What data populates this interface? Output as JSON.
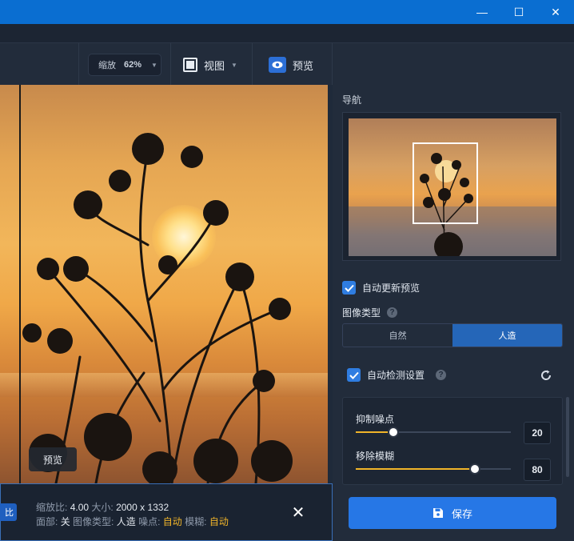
{
  "window": {
    "minimize_glyph": "—",
    "maximize_glyph": "☐",
    "close_glyph": "✕"
  },
  "toolbar": {
    "zoom_label": "缩放",
    "zoom_value": "62%",
    "view_label": "视图",
    "preview_label": "预览"
  },
  "canvas": {
    "preview_tag": "预览"
  },
  "infobar": {
    "left_button": "比",
    "zoom_ratio_label": "缩放比:",
    "zoom_ratio_value": "4.00",
    "size_label": "大小:",
    "size_value": "2000 x 1332",
    "face_label": "面部:",
    "face_value": "关",
    "image_type_label": "图像类型:",
    "image_type_value": "人造",
    "noise_label": "噪点:",
    "noise_value": "自动",
    "blur_label": "模糊:",
    "blur_value": "自动"
  },
  "panel": {
    "navigation_title": "导航",
    "auto_update_preview": "自动更新预览",
    "image_type_title": "图像类型",
    "image_type_options": [
      "自然",
      "人造"
    ],
    "image_type_selected": 1,
    "auto_detect_settings": "自动检测设置",
    "sliders": [
      {
        "label": "抑制噪点",
        "value": "20",
        "fraction": 0.24
      },
      {
        "label": "移除模糊",
        "value": "80",
        "fraction": 0.77
      }
    ],
    "save_label": "保存"
  },
  "colors": {
    "accent": "#2677e6",
    "titlebar": "#0a6ed1",
    "slider_fill": "#f0b429",
    "auto_value": "#f0b429"
  }
}
